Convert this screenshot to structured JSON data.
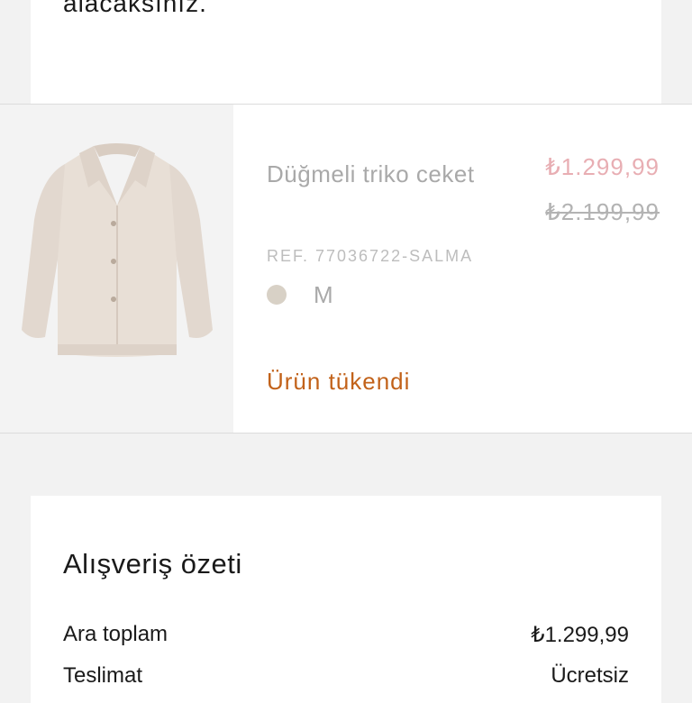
{
  "notice": {
    "text": "alacaksınız."
  },
  "product": {
    "name": "Düğmeli triko ceket",
    "price_current": "₺1.299,99",
    "price_original": "₺2.199,99",
    "ref": "REF. 77036722-SALMA",
    "color_hex": "#d8d1c6",
    "size": "M",
    "stock_status": "Ürün tükendi",
    "image_icon": "knit-jacket-image"
  },
  "summary": {
    "title": "Alışveriş özeti",
    "rows": [
      {
        "label": "Ara toplam",
        "value": "₺1.299,99"
      },
      {
        "label": "Teslimat",
        "value": "Ücretsiz"
      }
    ]
  },
  "colors": {
    "stock_status": "#c2621a",
    "sale_price": "#e8aeb3",
    "background": "#f2f2f2"
  }
}
